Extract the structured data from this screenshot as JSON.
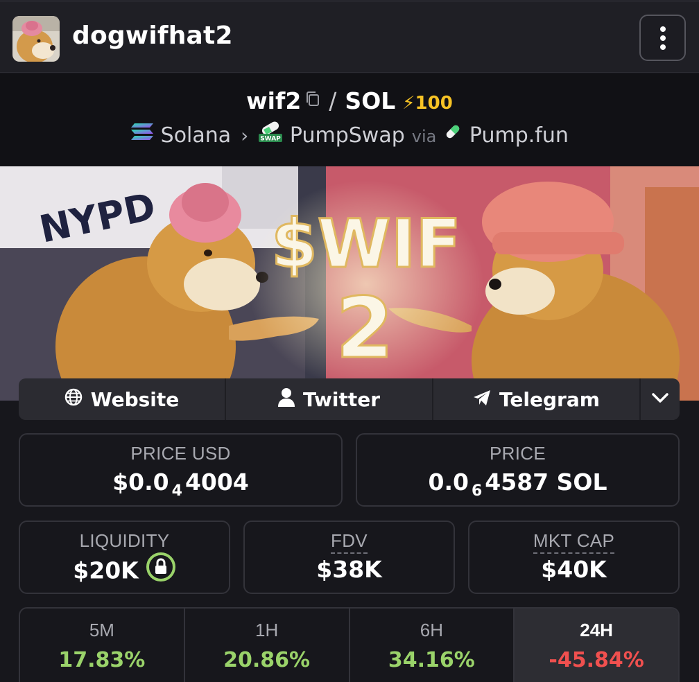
{
  "header": {
    "token_name": "dogwifhat2",
    "menu_icon": "more-vertical-icon"
  },
  "pair": {
    "base": "wif2",
    "separator": "/",
    "quote": "SOL",
    "boost": "100",
    "chain": "Solana",
    "dex": "PumpSwap",
    "via_label": "via",
    "launchpad": "Pump.fun",
    "colors": {
      "boost": "#f7c325",
      "pumpfun_green": "#4cd17a"
    }
  },
  "banner": {
    "sign_text": "NYPD",
    "title": "$WIF",
    "number": "2"
  },
  "links": [
    {
      "label": "Website",
      "icon": "globe-icon"
    },
    {
      "label": "Twitter",
      "icon": "user-icon"
    },
    {
      "label": "Telegram",
      "icon": "telegram-icon"
    }
  ],
  "stats": {
    "price_usd": {
      "label": "PRICE USD",
      "prefix": "$0.0",
      "zeros": "4",
      "digits": "4004"
    },
    "price": {
      "label": "PRICE",
      "prefix": "0.0",
      "zeros": "6",
      "digits": "4587",
      "unit": "SOL"
    },
    "liquidity": {
      "label": "LIQUIDITY",
      "value": "$20K",
      "icon": "lock-icon",
      "ring_color": "#9ad36a"
    },
    "fdv": {
      "label": "FDV",
      "value": "$38K"
    },
    "mkt_cap": {
      "label": "MKT CAP",
      "value": "$40K"
    }
  },
  "changes": [
    {
      "label": "5M",
      "value": "17.83%",
      "color": "#9ad36a"
    },
    {
      "label": "1H",
      "value": "20.86%",
      "color": "#9ad36a"
    },
    {
      "label": "6H",
      "value": "34.16%",
      "color": "#9ad36a"
    },
    {
      "label": "24H",
      "value": "-45.84%",
      "color": "#f0504f"
    }
  ]
}
